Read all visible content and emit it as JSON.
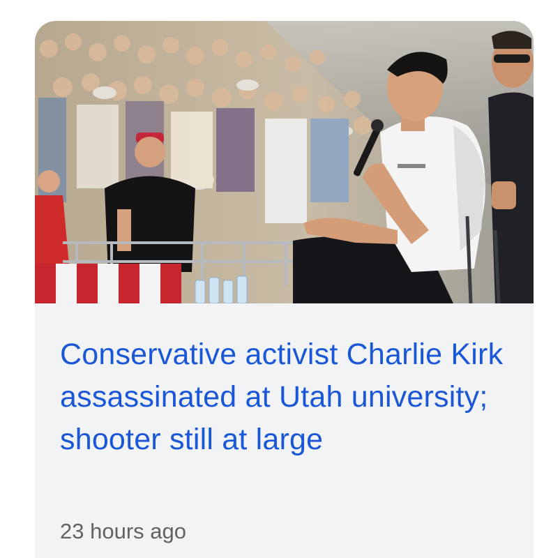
{
  "article": {
    "headline": "Conservative activist Charlie Kirk assassinated at Utah university; shooter still at large",
    "timestamp": "23 hours ago",
    "image_subject": "speaker-with-microphone-outdoor-crowd"
  },
  "colors": {
    "headline": "#1a57d6",
    "card_background": "#f1f3f4",
    "timestamp": "#5f6368"
  }
}
